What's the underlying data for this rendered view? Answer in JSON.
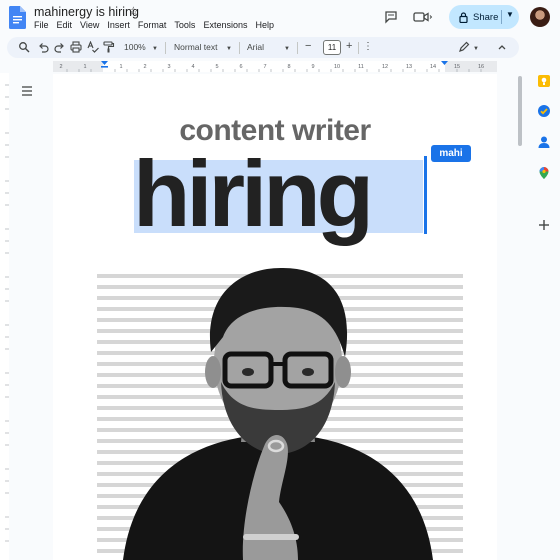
{
  "document": {
    "title": "mahinergy is hiring"
  },
  "menu": [
    "File",
    "Edit",
    "View",
    "Insert",
    "Format",
    "Tools",
    "Extensions",
    "Help"
  ],
  "share": {
    "label": "Share"
  },
  "toolbar": {
    "zoom": "100%",
    "style": "Normal text",
    "font": "Arial",
    "font_size": "11"
  },
  "ruler": {
    "numbers": [
      "2",
      "1",
      "1",
      "2",
      "3",
      "4",
      "5",
      "6",
      "7",
      "8",
      "9",
      "10",
      "11",
      "12",
      "13",
      "14",
      "15",
      "16",
      "17",
      "18"
    ]
  },
  "content": {
    "subheading": "content writer",
    "heading": "hiring",
    "tag": "mahi"
  },
  "colors": {
    "accent": "#1a73e8",
    "share_bg": "#c2e7ff",
    "toolbar_bg": "#edf2fa",
    "selection": "#c9defb"
  },
  "icons": {
    "titlebar": [
      "docs-logo-icon",
      "star-icon",
      "comment-icon",
      "video-call-icon",
      "lock-icon"
    ],
    "toolbar": [
      "search-icon",
      "undo-icon",
      "redo-icon",
      "print-icon",
      "spellcheck-icon",
      "paint-format-icon",
      "pen-icon"
    ],
    "side": [
      "keep-icon",
      "tasks-icon",
      "contacts-icon",
      "maps-icon",
      "add-icon"
    ]
  }
}
